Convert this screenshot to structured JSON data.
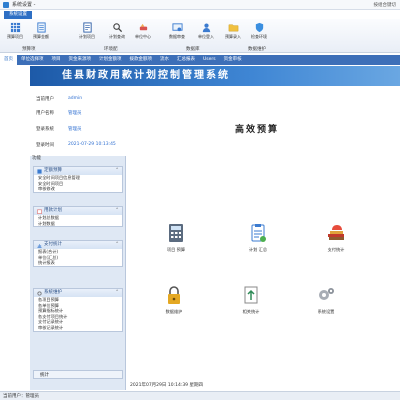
{
  "window": {
    "title": "系统设置 -",
    "hint": "按组合键切"
  },
  "ribbon": {
    "tab": "系统设置",
    "buttons": [
      {
        "label": "预算项目",
        "icon": "grid-icon"
      },
      {
        "label": "预算金额",
        "icon": "sheet-icon"
      },
      {
        "label": "计划项目",
        "icon": "list-icon"
      },
      {
        "label": "计划查询",
        "icon": "search-icon"
      },
      {
        "label": "单位中心",
        "icon": "hand-icon"
      },
      {
        "label": "数据审查",
        "icon": "audit-icon"
      },
      {
        "label": "单位登入",
        "icon": "user-icon"
      },
      {
        "label": "预算录入",
        "icon": "folder-icon"
      },
      {
        "label": "检查环境",
        "icon": "shield-icon"
      }
    ],
    "groups": [
      "预算项",
      "环境配",
      "数据库",
      "数据维护"
    ]
  },
  "nav": {
    "items": [
      "首页",
      "单位选择项",
      "项目",
      "资金来源项",
      "计划金额项",
      "拨款金额项",
      "流水",
      "汇总报表",
      "Users",
      "资金审核"
    ]
  },
  "banner": {
    "title": "佳县财政用款计划控制管理系统"
  },
  "info": {
    "rows": [
      {
        "label": "当前用户",
        "value": "admin"
      },
      {
        "label": "用户名称",
        "value": "管理员"
      },
      {
        "label": "登录系统",
        "value": "管理员"
      },
      {
        "label": "登录时间",
        "value": "2021-07-29 10:13:45"
      }
    ]
  },
  "hero": {
    "text": "高效预算"
  },
  "panel": {
    "head": "功能",
    "cards": [
      {
        "title": "定额预算",
        "icon": "calc-icon",
        "items": [
          "安全时间项目信息管理",
          "安全时间项目",
          "审核修改"
        ]
      },
      {
        "title": "用款计划",
        "icon": "calendar-icon",
        "items": [
          "计划总数据 ",
          "计划数据"
        ]
      },
      {
        "title": "支付统计",
        "icon": "chart-icon",
        "items": [
          "报表(合计)",
          "单位(汇总)",
          "统计报表"
        ]
      },
      {
        "title": "系统维护",
        "icon": "gear-icon",
        "items": [
          "各项目预算",
          "各单位预算",
          "预算指标统计",
          "各支付项目统计",
          "支付记录统计",
          "审核记录统计"
        ]
      }
    ],
    "stat_button": "统计"
  },
  "tiles": [
    {
      "label": "项目 预算",
      "icon": "calculator-icon"
    },
    {
      "label": "计划 汇总",
      "icon": "clipboard-icon"
    },
    {
      "label": "支付统计",
      "icon": "books-icon"
    },
    {
      "label": "数据维护",
      "icon": "lock-icon"
    },
    {
      "label": "相关统计",
      "icon": "doc-convert-icon"
    },
    {
      "label": "系统设置",
      "icon": "gears-icon"
    }
  ],
  "workspace": {
    "status": "2021年07月29日 10:14:39 星期四"
  },
  "statusbar": {
    "text": "当前用户：管理员"
  },
  "colors": {
    "accent": "#2e6fc4",
    "nav": "#3d6fb8",
    "panel": "#dfe8f4"
  }
}
